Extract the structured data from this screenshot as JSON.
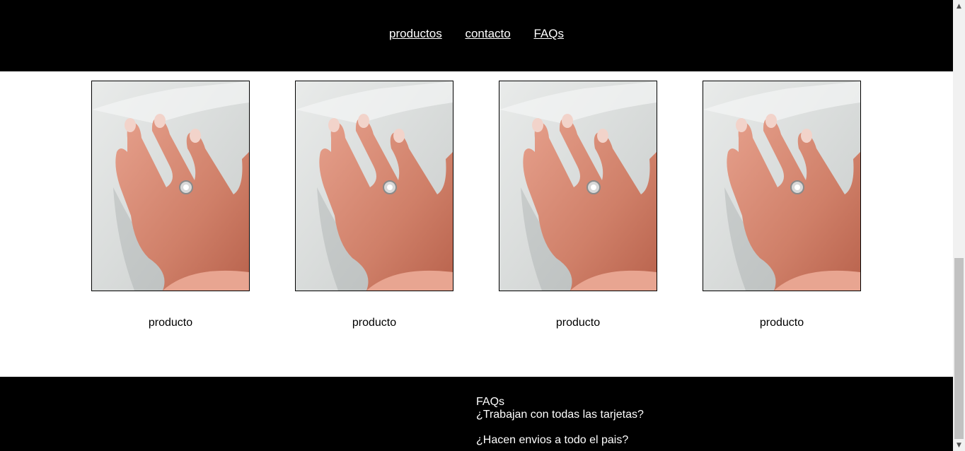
{
  "nav": {
    "links": [
      "productos",
      "contacto",
      "FAQs"
    ]
  },
  "products": [
    {
      "name": "producto"
    },
    {
      "name": "producto"
    },
    {
      "name": "producto"
    },
    {
      "name": "producto"
    }
  ],
  "footer": {
    "faq_title": "FAQs",
    "questions": [
      "¿Trabajan con todas las tarjetas?",
      "¿Hacen envios a todo el pais?"
    ]
  },
  "colors": {
    "header_bg": "#000000",
    "footer_bg": "#000000",
    "text_on_dark": "#ffffff"
  },
  "icons": {
    "scroll_up": "chevron-up-icon",
    "scroll_down": "chevron-down-icon"
  }
}
